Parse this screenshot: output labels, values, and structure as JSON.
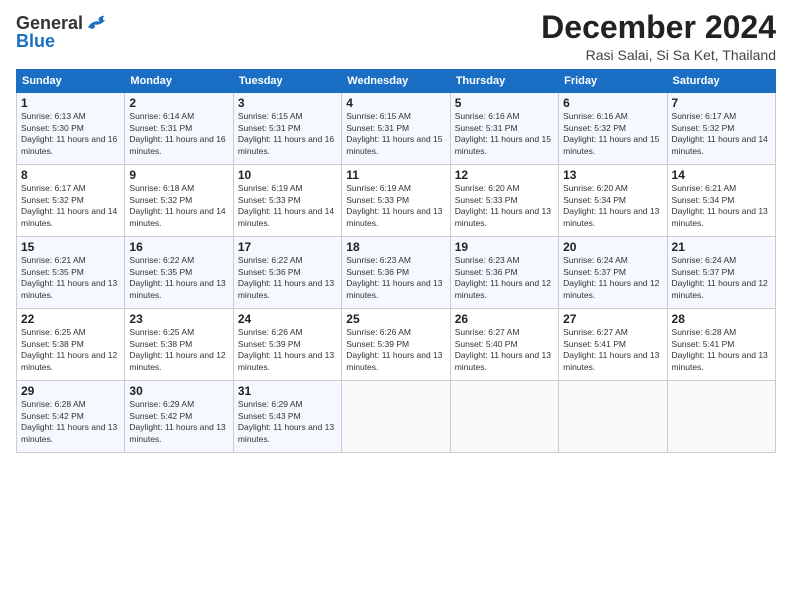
{
  "logo": {
    "general": "General",
    "blue": "Blue"
  },
  "header": {
    "month": "December 2024",
    "location": "Rasi Salai, Si Sa Ket, Thailand"
  },
  "days_of_week": [
    "Sunday",
    "Monday",
    "Tuesday",
    "Wednesday",
    "Thursday",
    "Friday",
    "Saturday"
  ],
  "weeks": [
    [
      {
        "day": "1",
        "rise": "6:13 AM",
        "set": "5:30 PM",
        "daylight": "11 hours and 16 minutes."
      },
      {
        "day": "2",
        "rise": "6:14 AM",
        "set": "5:31 PM",
        "daylight": "11 hours and 16 minutes."
      },
      {
        "day": "3",
        "rise": "6:15 AM",
        "set": "5:31 PM",
        "daylight": "11 hours and 16 minutes."
      },
      {
        "day": "4",
        "rise": "6:15 AM",
        "set": "5:31 PM",
        "daylight": "11 hours and 15 minutes."
      },
      {
        "day": "5",
        "rise": "6:16 AM",
        "set": "5:31 PM",
        "daylight": "11 hours and 15 minutes."
      },
      {
        "day": "6",
        "rise": "6:16 AM",
        "set": "5:32 PM",
        "daylight": "11 hours and 15 minutes."
      },
      {
        "day": "7",
        "rise": "6:17 AM",
        "set": "5:32 PM",
        "daylight": "11 hours and 14 minutes."
      }
    ],
    [
      {
        "day": "8",
        "rise": "6:17 AM",
        "set": "5:32 PM",
        "daylight": "11 hours and 14 minutes."
      },
      {
        "day": "9",
        "rise": "6:18 AM",
        "set": "5:32 PM",
        "daylight": "11 hours and 14 minutes."
      },
      {
        "day": "10",
        "rise": "6:19 AM",
        "set": "5:33 PM",
        "daylight": "11 hours and 14 minutes."
      },
      {
        "day": "11",
        "rise": "6:19 AM",
        "set": "5:33 PM",
        "daylight": "11 hours and 13 minutes."
      },
      {
        "day": "12",
        "rise": "6:20 AM",
        "set": "5:33 PM",
        "daylight": "11 hours and 13 minutes."
      },
      {
        "day": "13",
        "rise": "6:20 AM",
        "set": "5:34 PM",
        "daylight": "11 hours and 13 minutes."
      },
      {
        "day": "14",
        "rise": "6:21 AM",
        "set": "5:34 PM",
        "daylight": "11 hours and 13 minutes."
      }
    ],
    [
      {
        "day": "15",
        "rise": "6:21 AM",
        "set": "5:35 PM",
        "daylight": "11 hours and 13 minutes."
      },
      {
        "day": "16",
        "rise": "6:22 AM",
        "set": "5:35 PM",
        "daylight": "11 hours and 13 minutes."
      },
      {
        "day": "17",
        "rise": "6:22 AM",
        "set": "5:36 PM",
        "daylight": "11 hours and 13 minutes."
      },
      {
        "day": "18",
        "rise": "6:23 AM",
        "set": "5:36 PM",
        "daylight": "11 hours and 13 minutes."
      },
      {
        "day": "19",
        "rise": "6:23 AM",
        "set": "5:36 PM",
        "daylight": "11 hours and 12 minutes."
      },
      {
        "day": "20",
        "rise": "6:24 AM",
        "set": "5:37 PM",
        "daylight": "11 hours and 12 minutes."
      },
      {
        "day": "21",
        "rise": "6:24 AM",
        "set": "5:37 PM",
        "daylight": "11 hours and 12 minutes."
      }
    ],
    [
      {
        "day": "22",
        "rise": "6:25 AM",
        "set": "5:38 PM",
        "daylight": "11 hours and 12 minutes."
      },
      {
        "day": "23",
        "rise": "6:25 AM",
        "set": "5:38 PM",
        "daylight": "11 hours and 12 minutes."
      },
      {
        "day": "24",
        "rise": "6:26 AM",
        "set": "5:39 PM",
        "daylight": "11 hours and 13 minutes."
      },
      {
        "day": "25",
        "rise": "6:26 AM",
        "set": "5:39 PM",
        "daylight": "11 hours and 13 minutes."
      },
      {
        "day": "26",
        "rise": "6:27 AM",
        "set": "5:40 PM",
        "daylight": "11 hours and 13 minutes."
      },
      {
        "day": "27",
        "rise": "6:27 AM",
        "set": "5:41 PM",
        "daylight": "11 hours and 13 minutes."
      },
      {
        "day": "28",
        "rise": "6:28 AM",
        "set": "5:41 PM",
        "daylight": "11 hours and 13 minutes."
      }
    ],
    [
      {
        "day": "29",
        "rise": "6:28 AM",
        "set": "5:42 PM",
        "daylight": "11 hours and 13 minutes."
      },
      {
        "day": "30",
        "rise": "6:29 AM",
        "set": "5:42 PM",
        "daylight": "11 hours and 13 minutes."
      },
      {
        "day": "31",
        "rise": "6:29 AM",
        "set": "5:43 PM",
        "daylight": "11 hours and 13 minutes."
      },
      null,
      null,
      null,
      null
    ]
  ]
}
